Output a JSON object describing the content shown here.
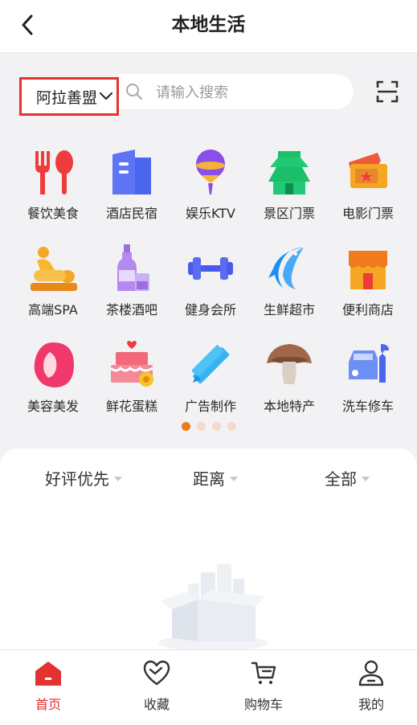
{
  "header": {
    "title": "本地生活"
  },
  "search": {
    "region": "阿拉善盟",
    "placeholder": "请输入搜索"
  },
  "categories": [
    {
      "label": "餐饮美食",
      "icon": "restaurant-icon"
    },
    {
      "label": "酒店民宿",
      "icon": "hotel-icon"
    },
    {
      "label": "娱乐KTV",
      "icon": "microphone-icon"
    },
    {
      "label": "景区门票",
      "icon": "pagoda-icon"
    },
    {
      "label": "电影门票",
      "icon": "movie-ticket-icon"
    },
    {
      "label": "高端SPA",
      "icon": "spa-icon"
    },
    {
      "label": "茶楼酒吧",
      "icon": "wine-bottle-icon"
    },
    {
      "label": "健身会所",
      "icon": "dumbbell-icon"
    },
    {
      "label": "生鲜超市",
      "icon": "fish-icon"
    },
    {
      "label": "便利商店",
      "icon": "store-icon"
    },
    {
      "label": "美容美发",
      "icon": "woman-hair-icon"
    },
    {
      "label": "鲜花蛋糕",
      "icon": "cake-icon"
    },
    {
      "label": "广告制作",
      "icon": "ruler-pencil-icon"
    },
    {
      "label": "本地特产",
      "icon": "mushroom-icon"
    },
    {
      "label": "洗车修车",
      "icon": "car-wrench-icon"
    }
  ],
  "pager": {
    "pages": 4,
    "active": 1
  },
  "filters": [
    {
      "label": "好评优先"
    },
    {
      "label": "距离"
    },
    {
      "label": "全部"
    }
  ],
  "tabbar": [
    {
      "label": "首页",
      "icon": "home-icon",
      "active": true
    },
    {
      "label": "收藏",
      "icon": "heart-icon",
      "active": false
    },
    {
      "label": "购物车",
      "icon": "cart-icon",
      "active": false
    },
    {
      "label": "我的",
      "icon": "user-icon",
      "active": false
    }
  ],
  "colors": {
    "accent": "#e3322f",
    "pager_active": "#f07a1e",
    "pager_inactive": "#f5d9c9"
  }
}
